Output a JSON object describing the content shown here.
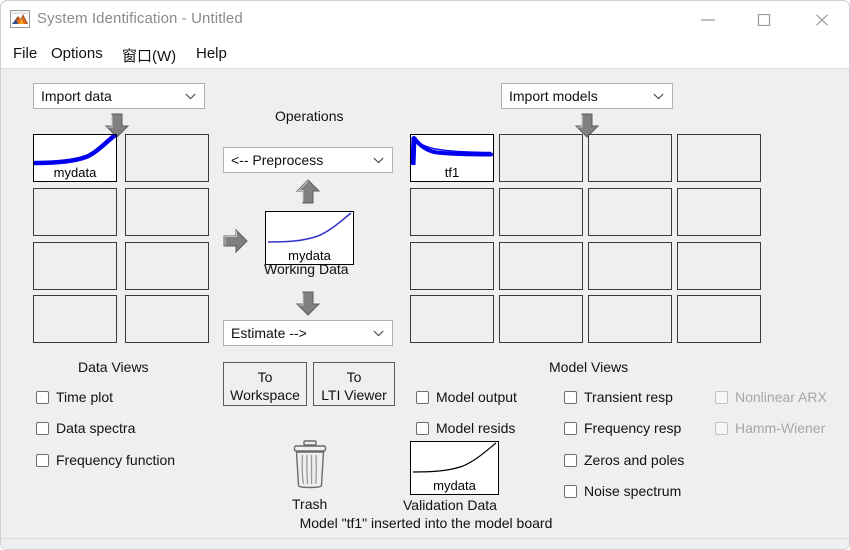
{
  "window": {
    "title": "System Identification - Untitled",
    "app_icon": "matlab-icon",
    "minimize_label": "—",
    "maximize_label": "□",
    "close_label": "✕"
  },
  "menu": {
    "items": [
      {
        "label": "File"
      },
      {
        "label": "Options"
      },
      {
        "label": "窗口(W)"
      },
      {
        "label": "Help"
      }
    ]
  },
  "data_panel": {
    "import_popup": {
      "value": "Import data",
      "chevron": "chevron-down-icon"
    },
    "views_caption": "Data Views",
    "board": {
      "rows": 4,
      "cols": 2,
      "cells": [
        {
          "name": "mydata",
          "filled": true,
          "thumb": "rising-curve"
        },
        {
          "name": "",
          "filled": false
        },
        {
          "name": "",
          "filled": false
        },
        {
          "name": "",
          "filled": false
        },
        {
          "name": "",
          "filled": false
        },
        {
          "name": "",
          "filled": false
        },
        {
          "name": "",
          "filled": false
        },
        {
          "name": "",
          "filled": false
        }
      ]
    },
    "checkboxes": [
      {
        "label": "Time plot",
        "checked": false,
        "enabled": true
      },
      {
        "label": "Data spectra",
        "checked": false,
        "enabled": true
      },
      {
        "label": "Frequency function",
        "checked": false,
        "enabled": true
      }
    ]
  },
  "operations": {
    "caption": "Operations",
    "preprocess_popup": {
      "value": "<-- Preprocess",
      "chevron": "chevron-down-icon"
    },
    "estimate_popup": {
      "value": "Estimate -->",
      "chevron": "chevron-down-icon"
    },
    "working_data": {
      "name": "mydata",
      "caption": "Working Data",
      "thumb": "rising-curve"
    },
    "buttons": [
      {
        "line1": "To",
        "line2": "Workspace"
      },
      {
        "line1": "To",
        "line2": "LTI Viewer"
      }
    ],
    "arrows": {
      "data_down": "arrow-down-icon",
      "model_down": "arrow-down-icon",
      "op_up": "arrow-up-icon",
      "op_down": "arrow-down-icon",
      "op_right": "arrow-right-icon"
    }
  },
  "model_panel": {
    "import_popup": {
      "value": "Import models",
      "chevron": "chevron-down-icon"
    },
    "views_caption": "Model Views",
    "board": {
      "rows": 4,
      "cols": 4,
      "cells": [
        {
          "name": "tf1",
          "filled": true,
          "thumb": "decay-curve"
        },
        {
          "name": "",
          "filled": false
        },
        {
          "name": "",
          "filled": false
        },
        {
          "name": "",
          "filled": false
        },
        {
          "name": "",
          "filled": false
        },
        {
          "name": "",
          "filled": false
        },
        {
          "name": "",
          "filled": false
        },
        {
          "name": "",
          "filled": false
        },
        {
          "name": "",
          "filled": false
        },
        {
          "name": "",
          "filled": false
        },
        {
          "name": "",
          "filled": false
        },
        {
          "name": "",
          "filled": false
        },
        {
          "name": "",
          "filled": false
        },
        {
          "name": "",
          "filled": false
        },
        {
          "name": "",
          "filled": false
        },
        {
          "name": "",
          "filled": false
        }
      ]
    },
    "checkboxes_col1": [
      {
        "label": "Model output",
        "checked": false,
        "enabled": true
      },
      {
        "label": "Model resids",
        "checked": false,
        "enabled": true
      }
    ],
    "checkboxes_col2": [
      {
        "label": "Transient resp",
        "checked": false,
        "enabled": true
      },
      {
        "label": "Frequency resp",
        "checked": false,
        "enabled": true
      },
      {
        "label": "Zeros and poles",
        "checked": false,
        "enabled": true
      },
      {
        "label": "Noise spectrum",
        "checked": false,
        "enabled": true
      }
    ],
    "checkboxes_col3": [
      {
        "label": "Nonlinear ARX",
        "checked": false,
        "enabled": false
      },
      {
        "label": "Hamm-Wiener",
        "checked": false,
        "enabled": false
      }
    ]
  },
  "trash": {
    "label": "Trash",
    "icon": "trash-icon"
  },
  "validation_data": {
    "name": "mydata",
    "caption": "Validation Data",
    "thumb": "rising-curve-thin"
  },
  "status": {
    "message": "Model \"tf1\" inserted into the model board"
  },
  "colors": {
    "background": "#efefef",
    "titlebar": "#ffffff",
    "curve_blue": "#0000ee",
    "curve_navy": "#3333cc",
    "arrow_gray": "#808080",
    "text": "#111111",
    "disabled_text": "#a6a6a6"
  }
}
